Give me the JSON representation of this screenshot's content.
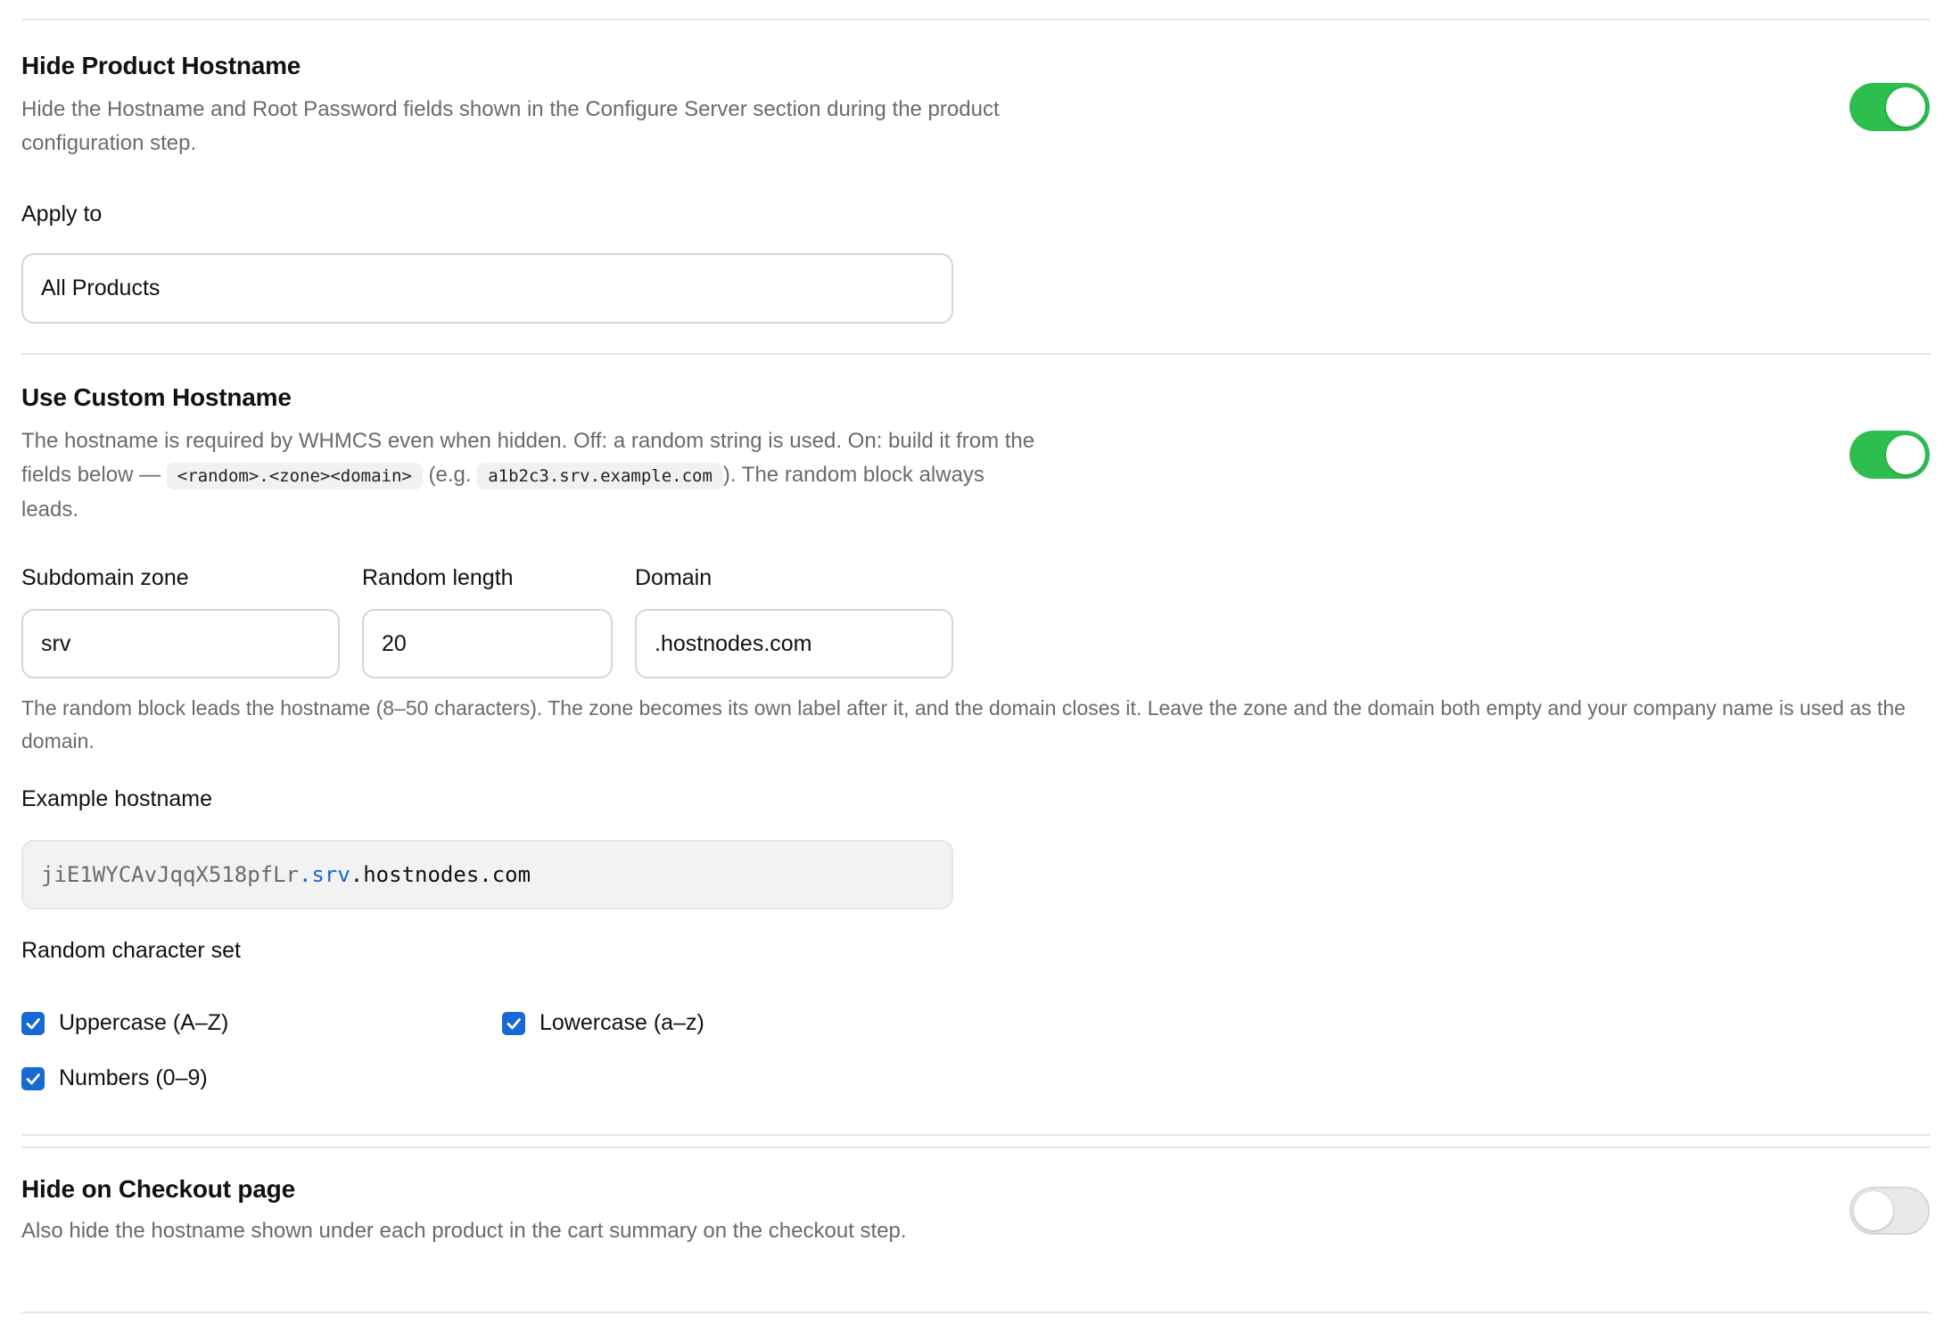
{
  "hide_product_hostname": {
    "title": "Hide Product Hostname",
    "description_line1": "Hide the Hostname and Root Password fields shown in the Configure Server section during the product",
    "description_line2": "configuration step.",
    "enabled": true,
    "apply_to_label": "Apply to",
    "apply_to_value": "All Products"
  },
  "custom_hostname": {
    "title": "Use Custom Hostname",
    "desc_line1": "The hostname is required by WHMCS even when hidden. Off: a random string is used. On: build it from the",
    "desc_line2_prefix": "fields below —",
    "desc_code_pattern": "<random>.<zone><domain>",
    "desc_eg_open": "(e.g.",
    "desc_code_example": "a1b2c3.srv.example.com",
    "desc_line2_suffix": "). The random block always",
    "desc_line3": "leads.",
    "enabled": true,
    "fields": {
      "zone_label": "Subdomain zone",
      "zone_value": "srv",
      "length_label": "Random length",
      "length_value": "20",
      "domain_label": "Domain",
      "domain_value": ".hostnodes.com"
    },
    "help_line1": "The random block leads the hostname (8–50 characters). The zone becomes its own label after it, and the domain closes it. Leave the zone and the domain both empty and your company name is used as the",
    "help_line2": "domain.",
    "example_label": "Example hostname",
    "example": {
      "random": "jiE1WYCAvJqqX518pfLr",
      "zone": ".srv",
      "domain": ".hostnodes.com"
    },
    "charset_label": "Random character set",
    "charset": {
      "uppercase": "Uppercase (A–Z)",
      "lowercase": "Lowercase (a–z)",
      "numbers": "Numbers (0–9)"
    }
  },
  "hide_checkout": {
    "title": "Hide on Checkout page",
    "description": "Also hide the hostname shown under each product in the cart summary on the checkout step.",
    "enabled": false
  },
  "colors": {
    "toggle_on": "#2dbe4e",
    "checkbox": "#1769d6",
    "zone_highlight": "#1a66c9"
  }
}
